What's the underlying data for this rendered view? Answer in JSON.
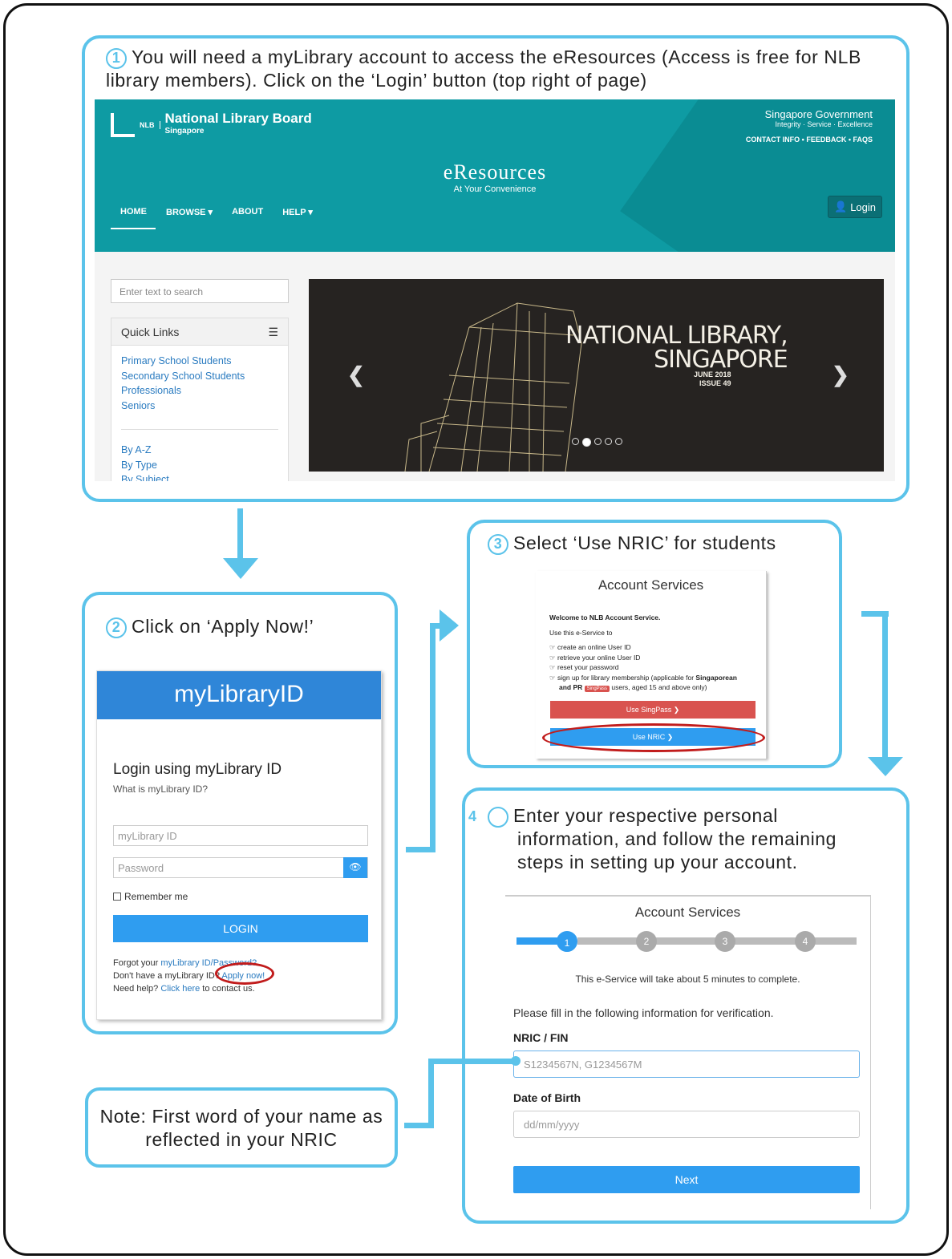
{
  "step1": {
    "num": "1",
    "text": "You will need a myLibrary account to access the eResources (Access is free for NLB library members). Click on the ‘Login’ button (top right of page)",
    "site": {
      "logo_abbr": "NLB",
      "org_name": "National Library Board",
      "org_sub": "Singapore",
      "gov_title": "Singapore Government",
      "gov_tagline": "Integrity · Service · Excellence",
      "gov_links": "CONTACT INFO • FEEDBACK • FAQS",
      "site_title": "eResources",
      "site_sub": "At Your Convenience",
      "nav": [
        "HOME",
        "BROWSE ▾",
        "ABOUT",
        "HELP ▾"
      ],
      "login": "Login",
      "search_placeholder": "Enter text to search",
      "quick_links_title": "Quick Links",
      "quick_links": [
        "Primary School Students",
        "Secondary School Students",
        "Professionals",
        "Seniors"
      ],
      "browse_links": [
        "By A-Z",
        "By Type",
        "By Subject"
      ],
      "banner_title_1": "NATIONAL LIBRARY,",
      "banner_title_2": "SINGAPORE",
      "banner_date": "JUNE 2018",
      "banner_issue": "ISSUE 49",
      "carousel_dot_active": 2,
      "carousel_dots": 5
    }
  },
  "step2": {
    "num": "2",
    "text": "Click on ‘Apply Now!’",
    "brand": "myLibraryID",
    "heading": "Login using myLibrary ID",
    "what_is": "What is myLibrary ID?",
    "id_placeholder": "myLibrary ID",
    "password_placeholder": "Password",
    "remember": "Remember me",
    "login_button": "LOGIN",
    "forgot_prefix": "Forgot your ",
    "forgot_link": "myLibrary ID/Password?",
    "no_account_prefix": "Don't have a myLibrary ID? ",
    "apply_link": "Apply now!",
    "help_prefix": "Need help? ",
    "help_link": "Click here",
    "help_suffix": " to contact us."
  },
  "step3": {
    "num": "3",
    "text": "Select ‘Use NRIC’ for students",
    "title": "Account Services",
    "welcome": "Welcome to NLB Account Service.",
    "use_this": "Use this e-Service to",
    "items": [
      "create an online User ID",
      "retrieve your online User ID",
      "reset your password"
    ],
    "signup_a": "sign up for library membership (applicable for ",
    "signup_b": "Singaporean",
    "signup_c": "and PR",
    "singpass_tag": "SingPass",
    "signup_d": " users, aged 15 and above only)",
    "singpass_button": "Use SingPass ❯",
    "nric_button": "Use NRIC ❯"
  },
  "step4": {
    "num": "4",
    "text": "Enter your respective personal information, and follow the remaining steps in setting up your account.",
    "title": "Account Services",
    "steps": [
      "1",
      "2",
      "3",
      "4"
    ],
    "current_step": 1,
    "note": "This e-Service will take about 5 minutes to complete.",
    "fill": "Please fill in the following information for verification.",
    "nric_label": "NRIC / FIN",
    "nric_placeholder": "S1234567N, G1234567M",
    "dob_label": "Date of Birth",
    "dob_placeholder": "dd/mm/yyyy",
    "next": "Next"
  },
  "note_box": "Note: First word of your name as reflected in your NRIC",
  "colors": {
    "accent": "#5bc3ea",
    "nlb_teal": "#0e9ba3",
    "button_blue": "#2f9df0",
    "highlight_red": "#c11c1c"
  }
}
